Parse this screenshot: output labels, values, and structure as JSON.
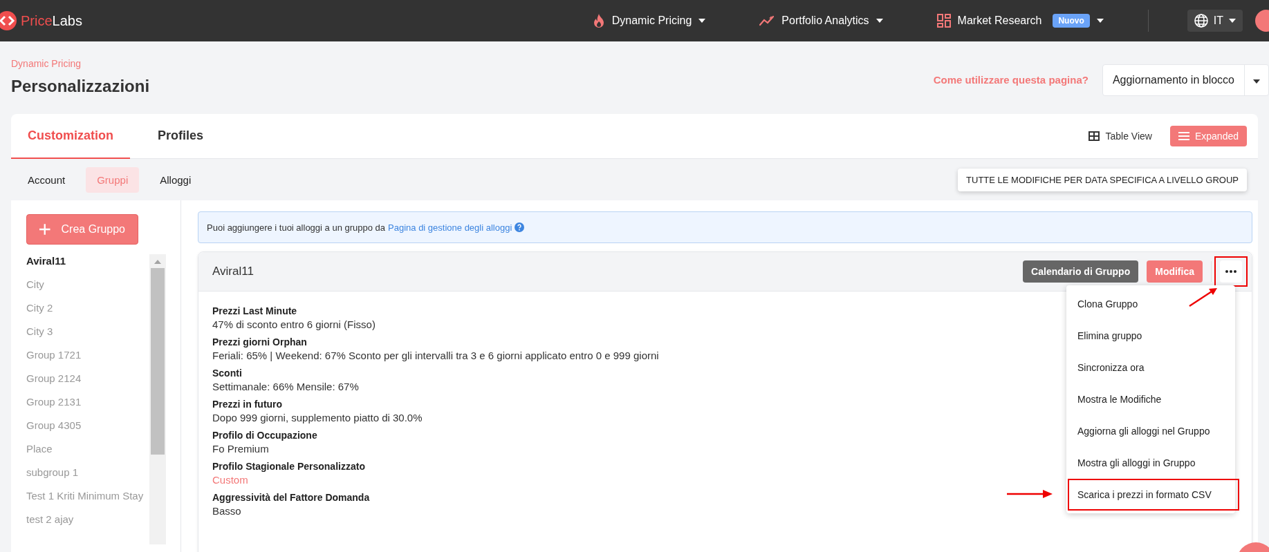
{
  "top_nav": {
    "logo": {
      "part_1": "Price",
      "part_2": "Labs"
    },
    "items": [
      {
        "kind": "flame",
        "label": "Dynamic Pricing"
      },
      {
        "kind": "trend",
        "label": "Portfolio Analytics"
      },
      {
        "kind": "grid",
        "label": "Market Research",
        "badge": "Nuovo"
      }
    ],
    "language": "IT"
  },
  "page": {
    "breadcrumb": "Dynamic Pricing",
    "title": "Personalizzazioni",
    "help_link": "Come utilizzare questa pagina?",
    "bulk_button": "Aggiornamento in blocco"
  },
  "tabs": [
    {
      "label": "Customization",
      "selected": true
    },
    {
      "label": "Profiles",
      "selected": false
    }
  ],
  "view_toggle": [
    {
      "kind": "table",
      "label": "Table View",
      "selected": false
    },
    {
      "kind": "list",
      "label": "Expanded",
      "selected": true
    }
  ],
  "sub_tabs": [
    {
      "label": "Account",
      "selected": false
    },
    {
      "label": "Gruppi",
      "selected": true
    },
    {
      "label": "Alloggi",
      "selected": false
    }
  ],
  "date_changes_button": "TUTTE LE MODIFICHE PER DATA SPECIFICA A LIVELLO GROUP",
  "sidebar": {
    "create_button": "Crea Gruppo",
    "items": [
      {
        "label": "Aviral11",
        "selected": true
      },
      {
        "label": "City",
        "selected": false
      },
      {
        "label": "City 2",
        "selected": false
      },
      {
        "label": "City 3",
        "selected": false
      },
      {
        "label": "Group 1721",
        "selected": false
      },
      {
        "label": "Group 2124",
        "selected": false
      },
      {
        "label": "Group 2131",
        "selected": false
      },
      {
        "label": "Group 4305",
        "selected": false
      },
      {
        "label": "Place",
        "selected": false
      },
      {
        "label": "subgroup 1",
        "selected": false
      },
      {
        "label": "Test 1 Kriti Minimum Stay",
        "selected": false
      },
      {
        "label": "test 2 ajay",
        "selected": false
      }
    ]
  },
  "info": {
    "text": "Puoi aggiungere i tuoi alloggi a un gruppo da",
    "link": "Pagina di gestione degli alloggi"
  },
  "group_card": {
    "name": "Aviral11",
    "buttons": [
      {
        "kind": "dark",
        "label": "Calendario di Gruppo"
      },
      {
        "kind": "primary",
        "label": "Modifica"
      }
    ],
    "more_button": {
      "annotated": true
    },
    "details": [
      {
        "label": "Prezzi Last Minute",
        "value": "47% di sconto entro 6 giorni (Fisso)",
        "kind": "text"
      },
      {
        "label": "Prezzi giorni Orphan",
        "value": "Feriali: 65% | Weekend: 67% Sconto per gli intervalli tra 3 e 6 giorni applicato entro 0 e 999 giorni",
        "kind": "text"
      },
      {
        "label": "Sconti",
        "value": "Settimanale: 66% Mensile: 67%",
        "kind": "text"
      },
      {
        "label": "Prezzi in futuro",
        "value": "Dopo 999 giorni, supplemento piatto di 30.0%",
        "kind": "text"
      },
      {
        "label": "Profilo di Occupazione",
        "value": "Fo Premium",
        "kind": "text"
      },
      {
        "label": "Profilo Stagionale Personalizzato",
        "value": "Custom",
        "kind": "link"
      },
      {
        "label": "Aggressività del Fattore Domanda",
        "value": "Basso",
        "kind": "text"
      }
    ],
    "menu": {
      "open": true,
      "items": [
        {
          "label": "Clona Gruppo",
          "annotated": false
        },
        {
          "label": "Elimina gruppo",
          "annotated": false
        },
        {
          "label": "Sincronizza ora",
          "annotated": false
        },
        {
          "label": "Mostra le Modifiche",
          "annotated": false
        },
        {
          "label": "Aggiorna gli alloggi nel Gruppo",
          "annotated": false
        },
        {
          "label": "Mostra gli alloggi in Gruppo",
          "annotated": false
        },
        {
          "label": "Scarica i prezzi in formato CSV",
          "annotated": true
        }
      ]
    }
  }
}
